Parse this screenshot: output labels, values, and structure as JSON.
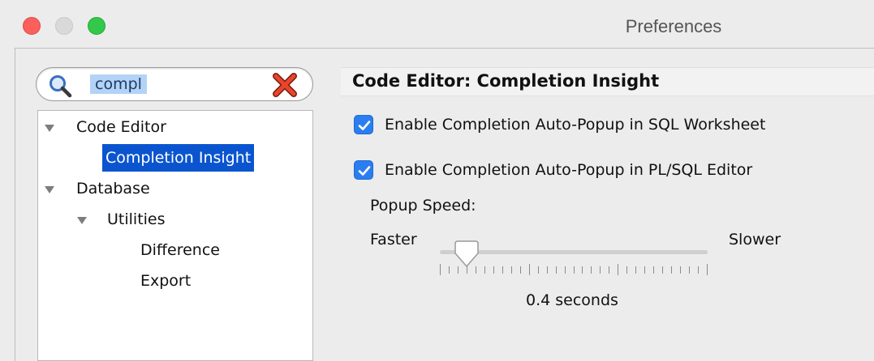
{
  "window": {
    "title": "Preferences"
  },
  "search": {
    "value": "compl"
  },
  "tree": {
    "items": [
      {
        "label": "Code Editor",
        "expanded": true
      },
      {
        "label": "Completion Insight",
        "selected": true
      },
      {
        "label": "Database",
        "expanded": true
      },
      {
        "label": "Utilities",
        "expanded": true
      },
      {
        "label": "Difference"
      },
      {
        "label": "Export"
      }
    ]
  },
  "panel": {
    "title": "Code Editor: Completion Insight",
    "options": [
      {
        "label": "Enable Completion Auto-Popup in SQL Worksheet",
        "checked": true
      },
      {
        "label": "Enable Completion Auto-Popup in PL/SQL Editor",
        "checked": true
      }
    ],
    "popup_speed": {
      "label": "Popup Speed:",
      "min_label": "Faster",
      "max_label": "Slower",
      "value_text": "0.4 seconds",
      "position_fraction": 0.1
    }
  },
  "colors": {
    "accent": "#2a7ef0",
    "selection": "#0a55cf",
    "close": "#fc605c",
    "maximize": "#34c84a"
  }
}
